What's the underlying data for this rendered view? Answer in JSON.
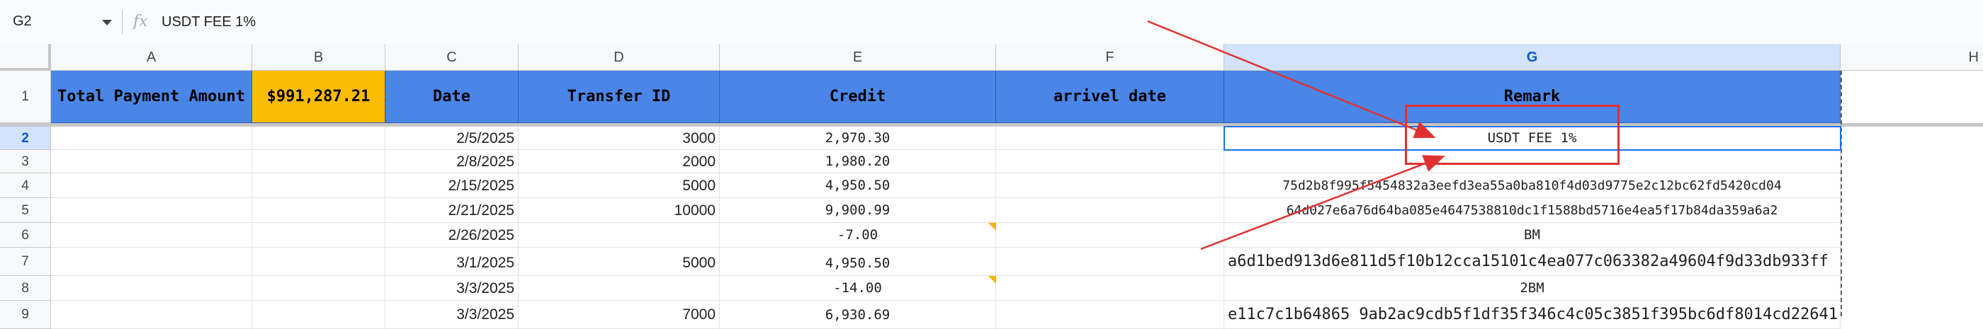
{
  "formula_bar": {
    "cell_ref": "G2",
    "fx": "fx",
    "value": "USDT FEE 1%"
  },
  "columns": [
    "A",
    "B",
    "C",
    "D",
    "E",
    "F",
    "G",
    "H"
  ],
  "header_row": {
    "row_number": "1",
    "cells": [
      "Total Payment Amount",
      "$991,287.21",
      "Date",
      "Transfer ID",
      "Credit",
      "arrivel date",
      "Remark"
    ]
  },
  "rows": [
    {
      "n": "2",
      "date": "2/5/2025",
      "transfer_id": "3000",
      "credit": "2,970.30",
      "remark": "USDT FEE 1%"
    },
    {
      "n": "3",
      "date": "2/8/2025",
      "transfer_id": "2000",
      "credit": "1,980.20",
      "remark": ""
    },
    {
      "n": "4",
      "date": "2/15/2025",
      "transfer_id": "5000",
      "credit": "4,950.50",
      "remark": "75d2b8f995f5454832a3eefd3ea55a0ba810f4d03d9775e2c12bc62fd5420cd04"
    },
    {
      "n": "5",
      "date": "2/21/2025",
      "transfer_id": "10000",
      "credit": "9,900.99",
      "remark": "64d027e6a76d64ba085e4647538810dc1f1588bd5716e4ea5f17b84da359a6a2"
    },
    {
      "n": "6",
      "date": "2/26/2025",
      "transfer_id": "",
      "credit": "-7.00",
      "remark": "BM"
    },
    {
      "n": "7",
      "date": "3/1/2025",
      "transfer_id": "5000",
      "credit": "4,950.50",
      "remark": "a6d1bed913d6e811d5f10b12cca15101c4ea077c063382a49604f9d33db933ff"
    },
    {
      "n": "8",
      "date": "3/3/2025",
      "transfer_id": "",
      "credit": "-14.00",
      "remark": "2BM"
    },
    {
      "n": "9",
      "date": "3/3/2025",
      "transfer_id": "7000",
      "credit": "6,930.69",
      "remark": "e11c7c1b64865 9ab2ac9cdb5f1df35f346c4c05c3851f395bc6df8014cd22641"
    }
  ]
}
